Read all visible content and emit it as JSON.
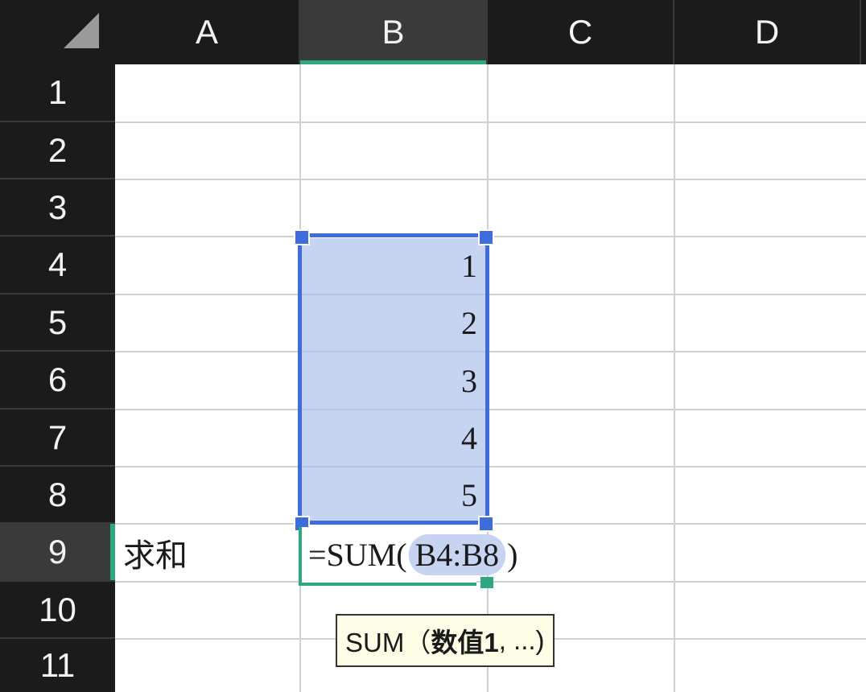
{
  "columns": [
    "A",
    "B",
    "C",
    "D"
  ],
  "active_column": "B",
  "rows": [
    "1",
    "2",
    "3",
    "4",
    "5",
    "6",
    "7",
    "8",
    "9",
    "10",
    "11"
  ],
  "active_row": "9",
  "cells": {
    "B4": "1",
    "B5": "2",
    "B6": "3",
    "B7": "4",
    "B8": "5",
    "A9": "求和"
  },
  "editing": {
    "cell": "B9",
    "formula_prefix": "=SUM(",
    "formula_ref": "B4:B8",
    "formula_suffix": ")"
  },
  "selection_range": "B4:B8",
  "tooltip": {
    "func": "SUM（",
    "arg": "数值1",
    "rest": ", ...)"
  },
  "colors": {
    "header_bg": "#1b1b1b",
    "active_header_bg": "#3a3a3a",
    "active_accent": "#2da882",
    "selection_fill": "#c6d4f1",
    "selection_border": "#3d6ddb",
    "gridline": "#d0d0d0",
    "tooltip_bg": "#fefee6"
  }
}
